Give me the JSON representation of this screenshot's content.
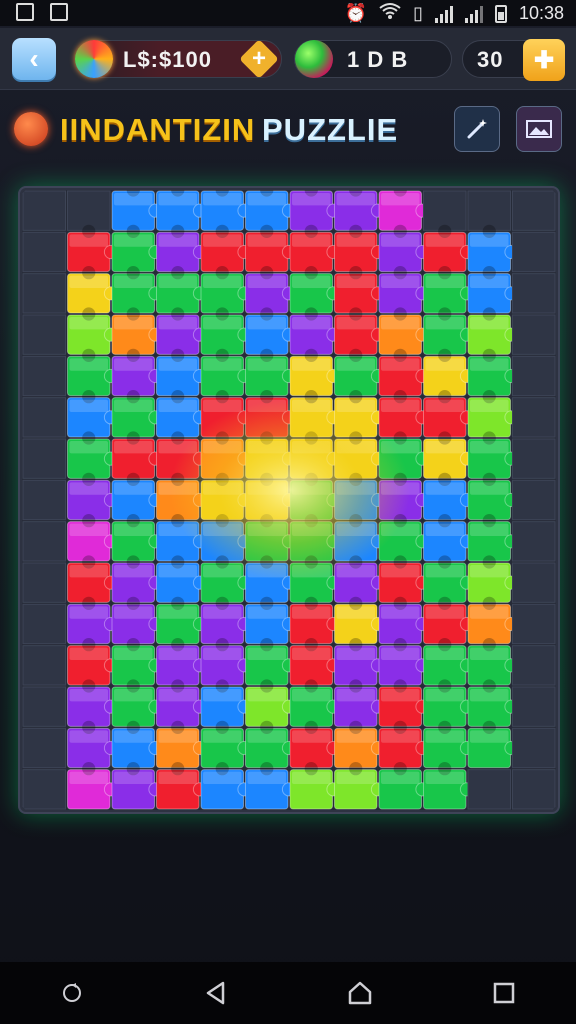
{
  "status_bar": {
    "time": "10:38",
    "left_icons": [
      "notification-icon",
      "image-icon"
    ],
    "right_icons": [
      "alarm-icon",
      "wifi-icon",
      "vibrate-icon",
      "signal-icon",
      "signal-icon",
      "battery-icon"
    ]
  },
  "top_bar": {
    "currency_label": "L$:$100",
    "gems_label": "1 D B",
    "lives_label": "30"
  },
  "title": {
    "part1": "IINDANTIZIN",
    "part2": "PUZZLIE"
  },
  "colors": {
    "red": "#f01f2e",
    "orange": "#ff8a1a",
    "yellow": "#f4d21a",
    "green": "#18c64a",
    "lime": "#7ee62a",
    "teal": "#12b89a",
    "blue": "#1c86ff",
    "purple": "#8a2ee8",
    "magenta": "#e02ad8",
    "gold": "#f6c21a",
    "accent_blue": "#6fb5ee"
  },
  "puzzle": {
    "rows": 13,
    "cols": 12,
    "tiles": [
      "xxBBBBPPMxxx",
      "xRGPRRRRPRBx",
      "xYGGGPGRPGBx",
      "xLOPGBPROGLx",
      "xGPBGGYGRYGx",
      "xBGBRRYYRRLx",
      "xGRROYYYGYGx",
      "xPBOYYGBPBGx",
      "xMGBBGGBGBGx",
      "xRPBGBGPRGLx",
      "xPPGPBRYPROx",
      "xRGPPGRPPGGx",
      "xPGPBLGPRGGx",
      "xPBOGGRORGGx",
      "xMPRBBLLGGxx"
    ],
    "legend": {
      "R": "red",
      "O": "orange",
      "Y": "yellow",
      "G": "green",
      "L": "lime",
      "T": "teal",
      "B": "blue",
      "P": "purple",
      "M": "magenta",
      "x": "empty"
    }
  },
  "nav_bar": {
    "buttons": [
      "refresh-icon",
      "back-triangle-icon",
      "home-icon",
      "recents-square-icon"
    ]
  }
}
